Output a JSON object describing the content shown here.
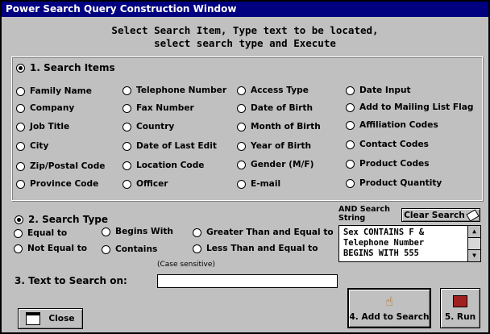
{
  "window": {
    "title": "Power Search Query Construction Window"
  },
  "instructions": {
    "line1": "Select Search Item, Type text to be located,",
    "line2": "select search type and Execute"
  },
  "search_items": {
    "header": "1. Search Items",
    "col1": [
      "Family Name",
      "Company",
      "Job Title",
      "City",
      "Zip/Postal Code",
      "Province Code"
    ],
    "col2": [
      "Telephone Number",
      "Fax Number",
      "Country",
      "Date of Last Edit",
      "Location Code",
      "Officer"
    ],
    "col3": [
      "Access Type",
      "Date of Birth",
      "Month of Birth",
      "Year of Birth",
      "Gender (M/F)",
      "E-mail"
    ],
    "col4": [
      "Date Input",
      "Add to Mailing List Flag",
      "Affiliation Codes",
      "Contact Codes",
      "Product Codes",
      "Product Quantity"
    ]
  },
  "search_type": {
    "header": "2. Search Type",
    "options": [
      "Equal to",
      "Begins With",
      "Greater Than and Equal to",
      "Not Equal to",
      "Contains",
      "Less Than and Equal to"
    ],
    "note": "(Case sensitive)"
  },
  "and_search": {
    "label_line1": "AND Search",
    "label_line2": "String",
    "clear_label": "Clear Search",
    "lines": [
      "Sex CONTAINS F &",
      "Telephone Number",
      "BEGINS WITH 555"
    ]
  },
  "text_search": {
    "label": "3. Text to Search on:",
    "value": ""
  },
  "buttons": {
    "close": "Close",
    "add": "4. Add to Search",
    "run": "5. Run"
  }
}
